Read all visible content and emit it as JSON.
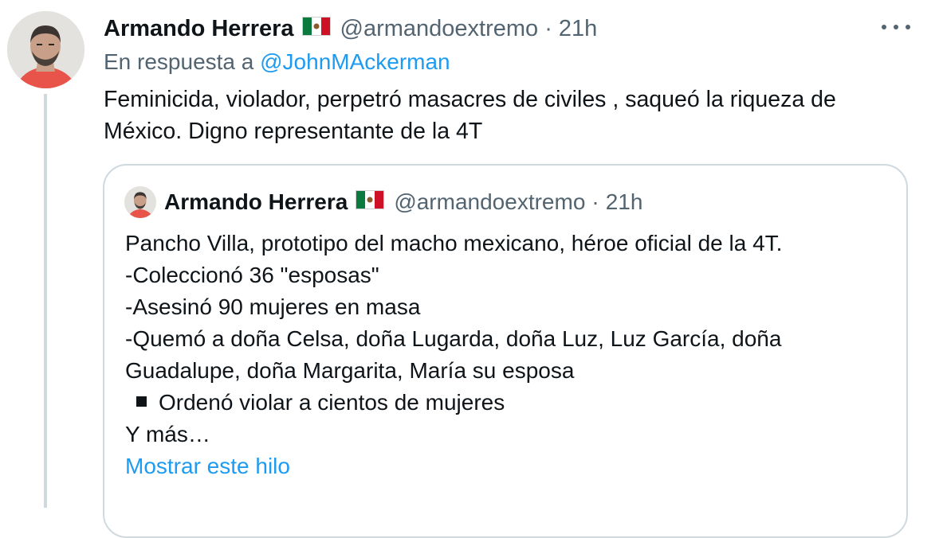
{
  "tweet": {
    "author_name": "Armando Herrera",
    "author_handle": "@armandoextremo",
    "separator": "·",
    "time": "21h",
    "reply_prefix": "En respuesta a",
    "reply_to": "@JohnMAckerman",
    "text_lines": [
      "Feminicida, violador, perpetró masacres de civiles , saqueó la riqueza de",
      "México. Digno representante de la 4T"
    ],
    "flag_icon": "mexico-flag-icon",
    "more_icon": "more-options-icon"
  },
  "quoted_tweet": {
    "author_name": "Armando Herrera",
    "author_handle": "@armandoextremo",
    "separator": "·",
    "time": "21h",
    "lines": [
      "Pancho Villa, prototipo del macho mexicano, héroe  oficial de la 4T.",
      "-Coleccionó 36 \"esposas\"",
      "-Asesinó 90 mujeres en masa",
      "-Quemó a doña Celsa, doña Lugarda, doña Luz, Luz García, doña",
      "Guadalupe, doña Margarita, María su esposa"
    ],
    "bullet_item": "Ordenó violar a cientos de mujeres",
    "closing": "Y más…",
    "show_thread": "Mostrar este hilo"
  },
  "colors": {
    "text": "#0f1419",
    "secondary": "#536471",
    "link": "#1d9bf0",
    "border": "#cfd9de"
  }
}
